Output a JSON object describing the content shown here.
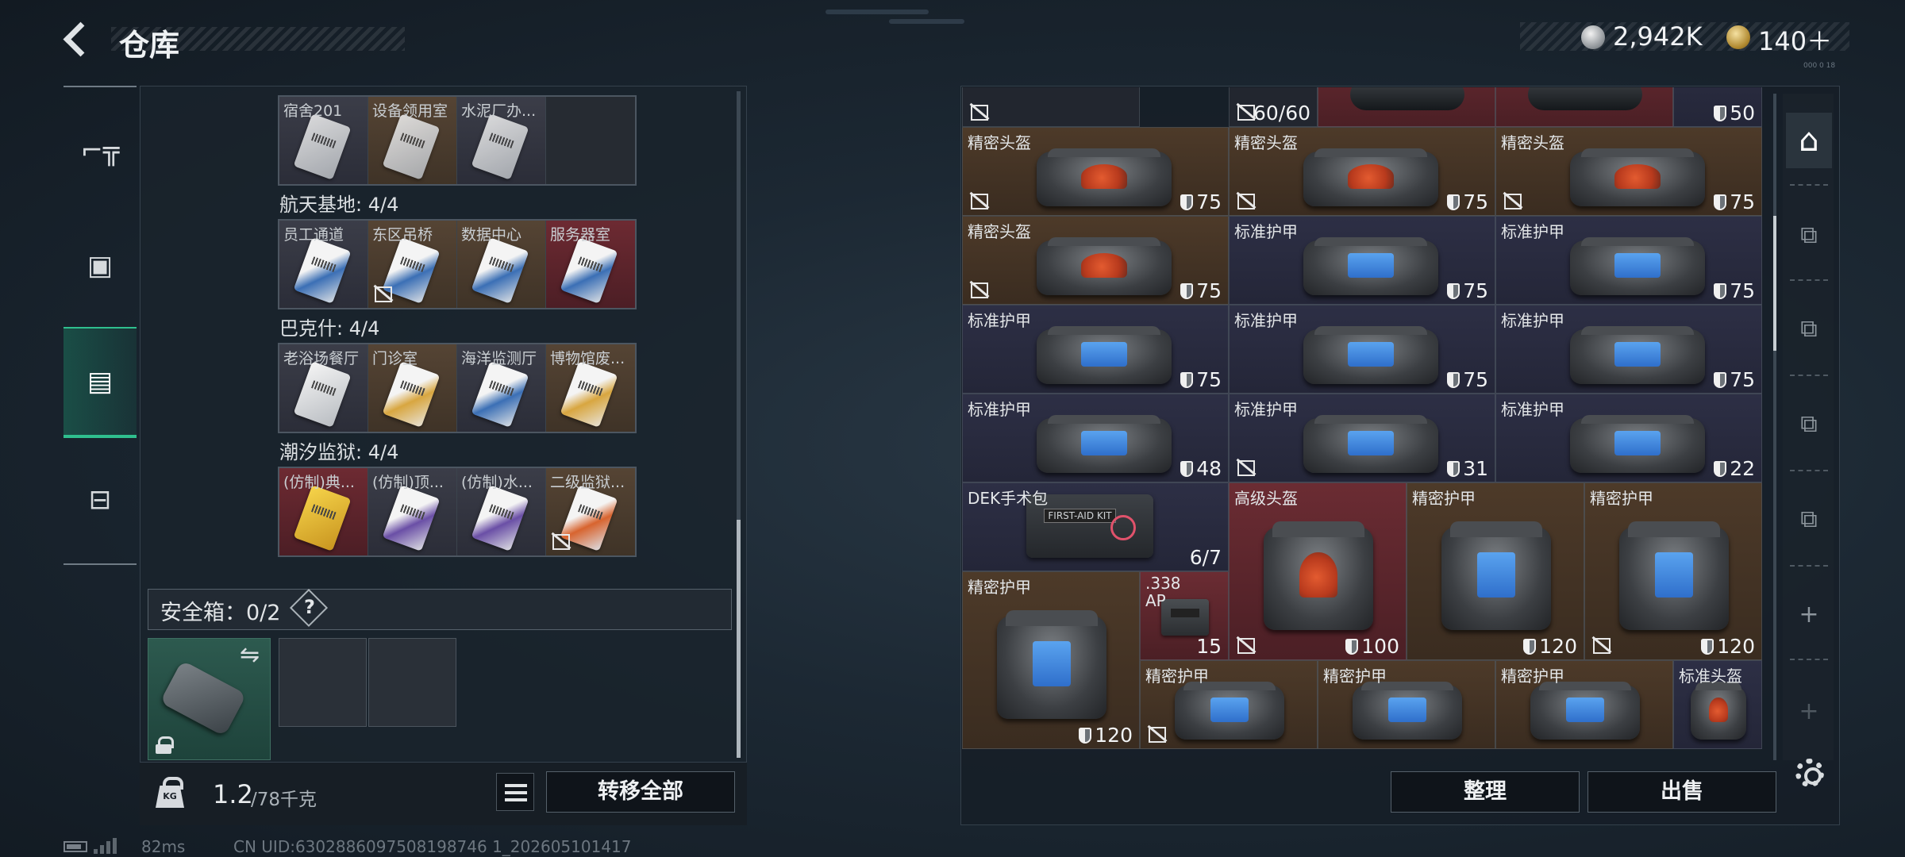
{
  "header": {
    "title": "仓库"
  },
  "currency": {
    "silver": "2,942K",
    "gold": "140＋",
    "tiny": "000 0 18"
  },
  "nav": {
    "items": [
      {
        "name": "weapons"
      },
      {
        "name": "gear"
      },
      {
        "name": "storage"
      },
      {
        "name": "toolbox"
      }
    ],
    "active": "storage"
  },
  "keys": {
    "rows": [
      {
        "title": "",
        "cards": [
          {
            "name": "宿舍201",
            "color": "gray",
            "tint": ""
          },
          {
            "name": "设备领用室",
            "color": "brown",
            "tint": ""
          },
          {
            "name": "水泥厂办...",
            "color": "gray",
            "tint": ""
          },
          {
            "name": "",
            "color": "empty",
            "tint": ""
          }
        ]
      },
      {
        "title": "航天基地: 4/4",
        "cards": [
          {
            "name": "员工通道",
            "color": "gray",
            "tint": "blue"
          },
          {
            "name": "东区吊桥",
            "color": "brown",
            "tint": "blue",
            "nodrop": true
          },
          {
            "name": "数据中心",
            "color": "brown",
            "tint": "blue"
          },
          {
            "name": "服务器室",
            "color": "red",
            "tint": "blue"
          }
        ]
      },
      {
        "title": "巴克什: 4/4",
        "cards": [
          {
            "name": "老浴场餐厅",
            "color": "gray",
            "tint": ""
          },
          {
            "name": "门诊室",
            "color": "brown",
            "tint": "gold"
          },
          {
            "name": "海洋监测厅",
            "color": "gray",
            "tint": "blue"
          },
          {
            "name": "博物馆废...",
            "color": "brown",
            "tint": "gold"
          }
        ]
      },
      {
        "title": "潮汐监狱: 4/4",
        "cards": [
          {
            "name": "(仿制)典...",
            "color": "red",
            "tint": "yellow"
          },
          {
            "name": "(仿制)顶...",
            "color": "gray",
            "tint": "purple"
          },
          {
            "name": "(仿制)水...",
            "color": "gray",
            "tint": "purple"
          },
          {
            "name": "二级监狱...",
            "color": "brown",
            "tint": "red",
            "nodrop": true
          }
        ]
      }
    ]
  },
  "safebox": {
    "label": "安全箱：0/2",
    "help": "?"
  },
  "capacity": {
    "value": "1.2",
    "max": "/78千克"
  },
  "buttons": {
    "transfer_all": "转移全部",
    "sort": "整理",
    "sell": "出售"
  },
  "stash": {
    "items": [
      {
        "name": "",
        "value": "60/60",
        "color": "dark",
        "kind": "none"
      },
      {
        "name": "",
        "value": "50",
        "shield": true,
        "color": "navy",
        "kind": "none"
      },
      {
        "name": "精密头盔",
        "value": "75",
        "shield": true,
        "color": "brown",
        "kind": "helmet"
      },
      {
        "name": "精密头盔",
        "value": "75",
        "shield": true,
        "color": "brown",
        "kind": "helmet"
      },
      {
        "name": "精密头盔",
        "value": "75",
        "shield": true,
        "color": "brown",
        "kind": "helmet"
      },
      {
        "name": "精密头盔",
        "value": "75",
        "shield": true,
        "color": "brown",
        "kind": "helmet"
      },
      {
        "name": "标准护甲",
        "value": "75",
        "shield": true,
        "color": "navy",
        "kind": "armor"
      },
      {
        "name": "标准护甲",
        "value": "75",
        "shield": true,
        "color": "navy",
        "kind": "armor"
      },
      {
        "name": "标准护甲",
        "value": "75",
        "shield": true,
        "color": "navy",
        "kind": "armor"
      },
      {
        "name": "标准护甲",
        "value": "75",
        "shield": true,
        "color": "navy",
        "kind": "armor"
      },
      {
        "name": "标准护甲",
        "value": "75",
        "shield": true,
        "color": "navy",
        "kind": "armor"
      },
      {
        "name": "标准护甲",
        "value": "48",
        "shield": true,
        "color": "navy",
        "kind": "armor"
      },
      {
        "name": "标准护甲",
        "value": "31",
        "shield": true,
        "color": "navy",
        "kind": "armor"
      },
      {
        "name": "标准护甲",
        "value": "22",
        "shield": true,
        "color": "navy",
        "kind": "armor"
      },
      {
        "name": "DEK手术包",
        "value": "6/7",
        "color": "navy",
        "kind": "medkit"
      },
      {
        "name": "高级头盔",
        "value": "100",
        "shield": true,
        "color": "red",
        "kind": "helmet"
      },
      {
        "name": "精密护甲",
        "value": "120",
        "shield": true,
        "color": "brown",
        "kind": "armor"
      },
      {
        "name": "精密护甲",
        "value": "120",
        "shield": true,
        "color": "brown",
        "kind": "armor"
      },
      {
        "name": "精密护甲",
        "value": "120",
        "shield": true,
        "color": "brown",
        "kind": "armor"
      },
      {
        "name": ".338 AP",
        "value": "15",
        "color": "red",
        "kind": "ammo"
      },
      {
        "name": "精密护甲",
        "value": "",
        "color": "brown",
        "kind": "armor"
      },
      {
        "name": "精密护甲",
        "value": "",
        "color": "brown",
        "kind": "armor"
      },
      {
        "name": "精密护甲",
        "value": "",
        "color": "brown",
        "kind": "armor"
      },
      {
        "name": "标准头盔",
        "value": "",
        "color": "navy",
        "kind": "helmet"
      }
    ]
  },
  "side_tools": [
    "armor-slot-icon",
    "weapon-mod-icon-3",
    "weapon-mod-icon-4a",
    "weapon-mod-icon-4b",
    "weapon-mod-icon-4c",
    "add-icon",
    "add-icon-disabled"
  ],
  "status": {
    "ping": "82ms",
    "uid": "CN UID:6302886097508198746 1_202605101417"
  }
}
